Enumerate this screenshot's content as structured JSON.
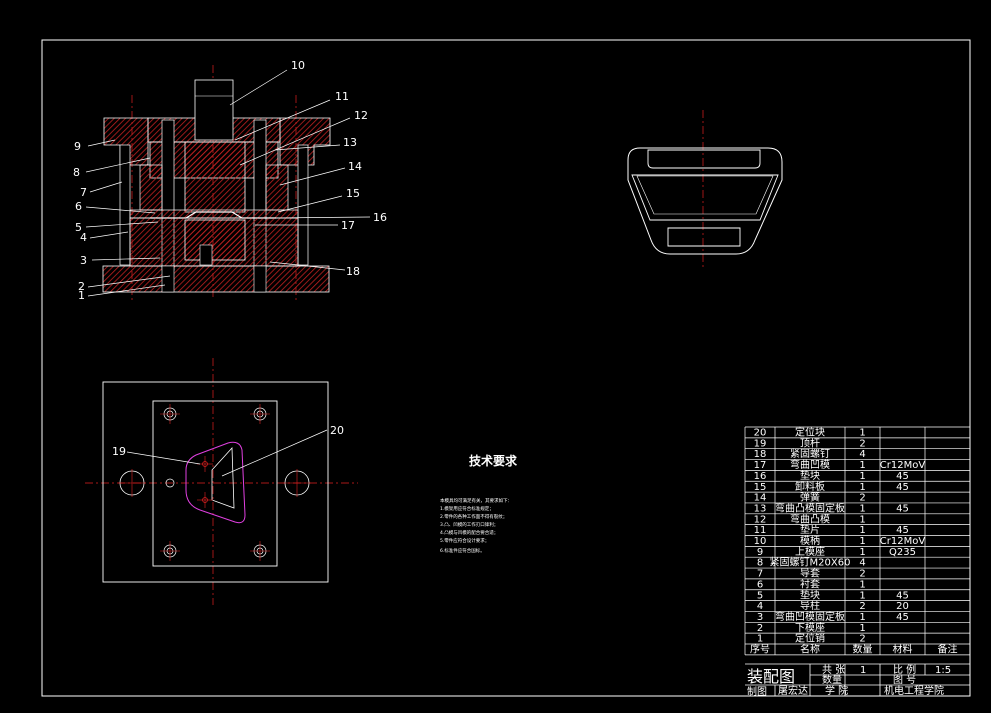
{
  "section_view_labels": [
    "1",
    "2",
    "3",
    "4",
    "5",
    "6",
    "7",
    "8",
    "9",
    "10",
    "11",
    "12",
    "13",
    "14",
    "15",
    "16",
    "17",
    "18"
  ],
  "plan_view_labels": [
    "19",
    "20"
  ],
  "tech_requirements": {
    "title": "技术要求",
    "lines": [
      "本模具均可满足有关，其要求如下：",
      "1.模架用应符合标准规定；",
      "2.零件的各种工作面不得有裂纹；",
      "3.凸、凹模的工作刃口锋利；",
      "4.凸模与凹模的配合要合适；",
      "5.零件应符合设计要求；",
      "6.标准件应符合国标。"
    ]
  },
  "bom": {
    "rows": [
      {
        "no": "20",
        "name": "定位块",
        "qty": "1",
        "material": ""
      },
      {
        "no": "19",
        "name": "顶杆",
        "qty": "2",
        "material": ""
      },
      {
        "no": "18",
        "name": "紧固螺钉",
        "qty": "4",
        "material": ""
      },
      {
        "no": "17",
        "name": "弯曲凹模",
        "qty": "1",
        "material": "Cr12MoV"
      },
      {
        "no": "16",
        "name": "垫块",
        "qty": "1",
        "material": "45"
      },
      {
        "no": "15",
        "name": "卸料板",
        "qty": "1",
        "material": "45"
      },
      {
        "no": "14",
        "name": "弹簧",
        "qty": "2",
        "material": ""
      },
      {
        "no": "13",
        "name": "弯曲凸模固定板",
        "qty": "1",
        "material": "45"
      },
      {
        "no": "12",
        "name": "弯曲凸模",
        "qty": "1",
        "material": ""
      },
      {
        "no": "11",
        "name": "垫片",
        "qty": "1",
        "material": "45"
      },
      {
        "no": "10",
        "name": "模柄",
        "qty": "1",
        "material": "Cr12MoV"
      },
      {
        "no": "9",
        "name": "上模座",
        "qty": "1",
        "material": "Q235"
      },
      {
        "no": "8",
        "name": "紧固螺钉M20X60",
        "qty": "4",
        "material": ""
      },
      {
        "no": "7",
        "name": "导套",
        "qty": "2",
        "material": ""
      },
      {
        "no": "6",
        "name": "衬套",
        "qty": "1",
        "material": ""
      },
      {
        "no": "5",
        "name": "垫块",
        "qty": "1",
        "material": "45"
      },
      {
        "no": "4",
        "name": "导柱",
        "qty": "2",
        "material": "20"
      },
      {
        "no": "3",
        "name": "弯曲凹模固定板",
        "qty": "1",
        "material": "45"
      },
      {
        "no": "2",
        "name": "下模座",
        "qty": "1",
        "material": ""
      },
      {
        "no": "1",
        "name": "定位销",
        "qty": "2",
        "material": ""
      }
    ],
    "header": {
      "no": "序号",
      "name": "名称",
      "qty": "数量",
      "material": "材料",
      "remark": "备注"
    }
  },
  "title_block": {
    "drawing_name": "装配图",
    "total_label": "共 张",
    "total_value": "1",
    "scale_label": "比 例",
    "scale_value": "1:5",
    "qty_label": "数量",
    "drawing_no_label": "图 号",
    "drawn_label": "制图",
    "drawer": "屠宏达",
    "school_label": "学 院",
    "school": "机电工程学院"
  }
}
